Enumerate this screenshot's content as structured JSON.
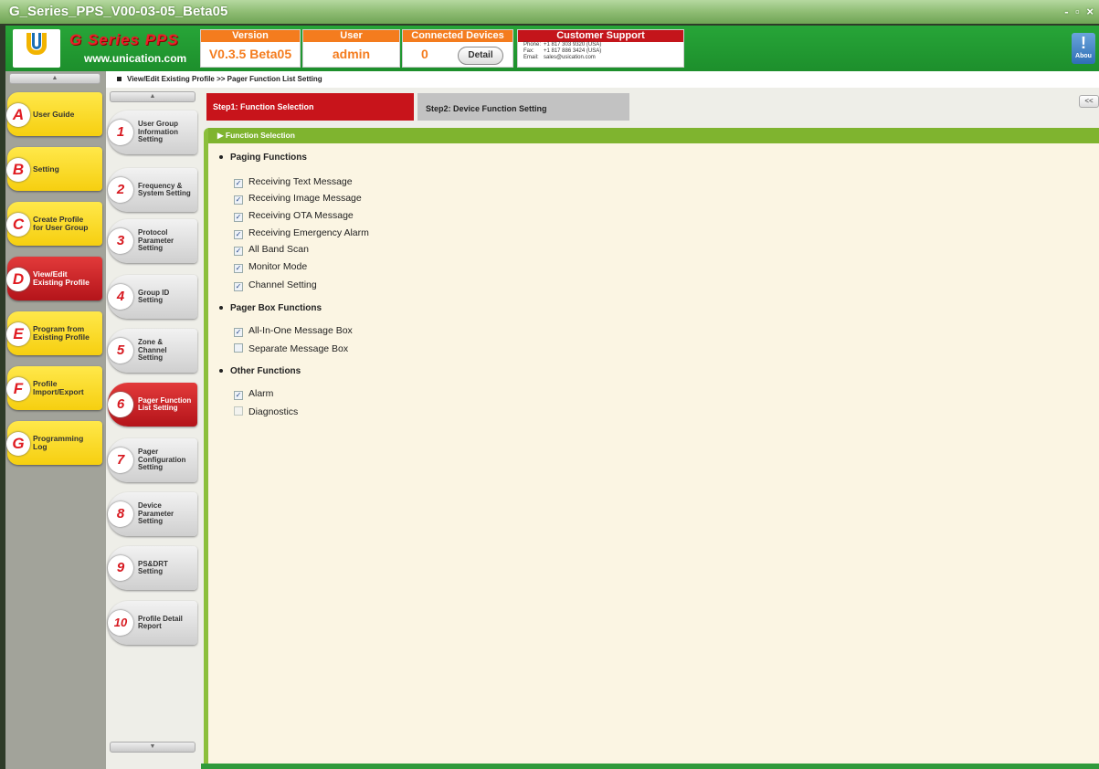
{
  "window": {
    "title": "G_Series_PPS_V00-03-05_Beta05",
    "controls": "- ▫ ×"
  },
  "header": {
    "logo_text": "Unication",
    "brand": "G Series PPS",
    "website": "www.unication.com",
    "version_caption": "Version",
    "version_value": "V0.3.5 Beta05",
    "user_caption": "User",
    "user_value": "admin",
    "devices_caption": "Connected Devices",
    "devices_value": "0",
    "detail_label": "Detail",
    "support_caption": "Customer Support",
    "support": [
      {
        "label": "Phone:",
        "value": "+1 817 303 9320 (USA)"
      },
      {
        "label": "Fax:",
        "value": "+1 817 886 3424 (USA)"
      },
      {
        "label": "Email:",
        "value": "sales@usication.com"
      }
    ],
    "about_label": "Abou"
  },
  "breadcrumb": "View/Edit Existing Profile >> Pager Function List Setting",
  "main_nav": [
    {
      "letter": "A",
      "label": "User Guide"
    },
    {
      "letter": "B",
      "label": "Setting"
    },
    {
      "letter": "C",
      "label": "Create Profile\nfor User Group"
    },
    {
      "letter": "D",
      "label": "View/Edit\nExisting Profile",
      "active": true
    },
    {
      "letter": "E",
      "label": "Program from\nExisting Profile"
    },
    {
      "letter": "F",
      "label": "Profile\nImport/Export"
    },
    {
      "letter": "G",
      "label": "Programming\nLog"
    }
  ],
  "sub_nav": [
    {
      "num": "1",
      "label": "User Group\nInformation\nSetting"
    },
    {
      "num": "2",
      "label": "Frequency &\nSystem Setting"
    },
    {
      "num": "3",
      "label": "Protocol\nParameter\nSetting"
    },
    {
      "num": "4",
      "label": "Group ID\nSetting"
    },
    {
      "num": "5",
      "label": "Zone &\nChannel\nSetting"
    },
    {
      "num": "6",
      "label": "Pager Function\nList Setting",
      "active": true
    },
    {
      "num": "7",
      "label": "Pager\nConfiguration\nSetting"
    },
    {
      "num": "8",
      "label": "Device\nParameter\nSetting"
    },
    {
      "num": "9",
      "label": "PS&DRT\nSetting"
    },
    {
      "num": "10",
      "label": "Profile Detail\nReport"
    }
  ],
  "tabs": {
    "step1": "Step1: Function Selection",
    "step2": "Step2: Device Function Setting",
    "back": "<<"
  },
  "panel_title": "▶ Function Selection",
  "sections": [
    {
      "title": "Paging Functions",
      "items": [
        {
          "label": "Receiving Text Message",
          "checked": true
        },
        {
          "label": "Receiving Image Message",
          "checked": true
        },
        {
          "label": "Receiving OTA Message",
          "checked": true
        },
        {
          "label": "Receiving Emergency Alarm",
          "checked": true
        },
        {
          "label": "All Band Scan",
          "checked": true
        },
        {
          "label": "Monitor Mode",
          "checked": true
        },
        {
          "label": "Channel Setting",
          "checked": true
        }
      ]
    },
    {
      "title": "Pager Box Functions",
      "items": [
        {
          "label": "All-In-One Message Box",
          "checked": true
        },
        {
          "label": "Separate Message Box",
          "checked": false
        }
      ]
    },
    {
      "title": "Other Functions",
      "items": [
        {
          "label": "Alarm",
          "checked": true
        },
        {
          "label": "Diagnostics",
          "checked": false
        }
      ]
    }
  ]
}
